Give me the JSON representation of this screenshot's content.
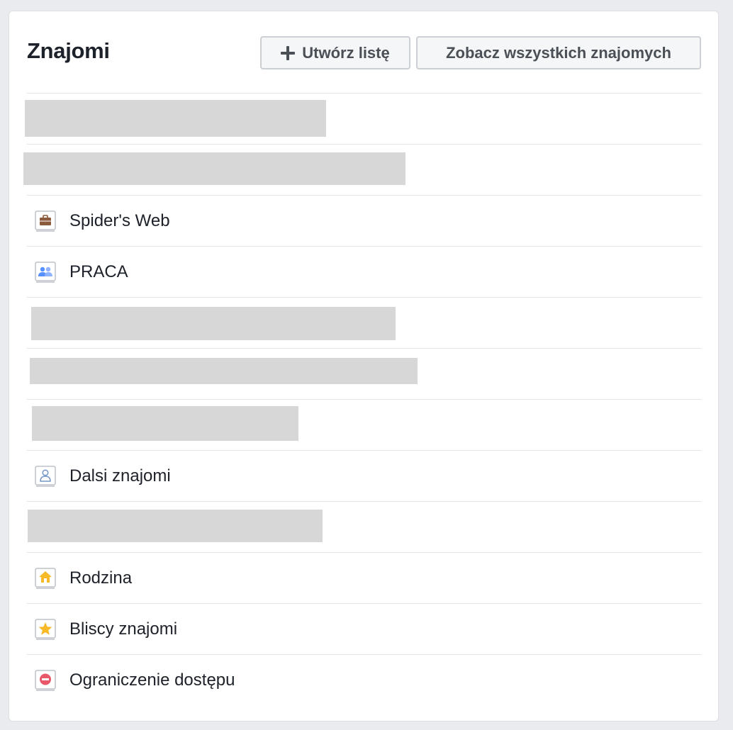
{
  "header": {
    "title": "Znajomi",
    "create_list_label": "Utwórz listę",
    "see_all_label": "Zobacz wszystkich znajomych"
  },
  "lists": [
    {
      "type": "redacted"
    },
    {
      "type": "redacted"
    },
    {
      "type": "list",
      "label": "Spider's Web",
      "icon": "briefcase-icon"
    },
    {
      "type": "list",
      "label": "PRACA",
      "icon": "people-icon"
    },
    {
      "type": "redacted"
    },
    {
      "type": "redacted"
    },
    {
      "type": "redacted"
    },
    {
      "type": "list",
      "label": "Dalsi znajomi",
      "icon": "person-outline-icon"
    },
    {
      "type": "redacted"
    },
    {
      "type": "list",
      "label": "Rodzina",
      "icon": "house-icon"
    },
    {
      "type": "list",
      "label": "Bliscy znajomi",
      "icon": "star-icon"
    },
    {
      "type": "list",
      "label": "Ograniczenie dostępu",
      "icon": "restricted-icon"
    }
  ],
  "colors": {
    "background": "#e9ebee",
    "redacted": "#d7d7d7",
    "briefcase": "#8b5a3c",
    "people": "#5890ff",
    "house": "#f7b928",
    "star": "#f7b928",
    "restricted": "#e9576b"
  }
}
